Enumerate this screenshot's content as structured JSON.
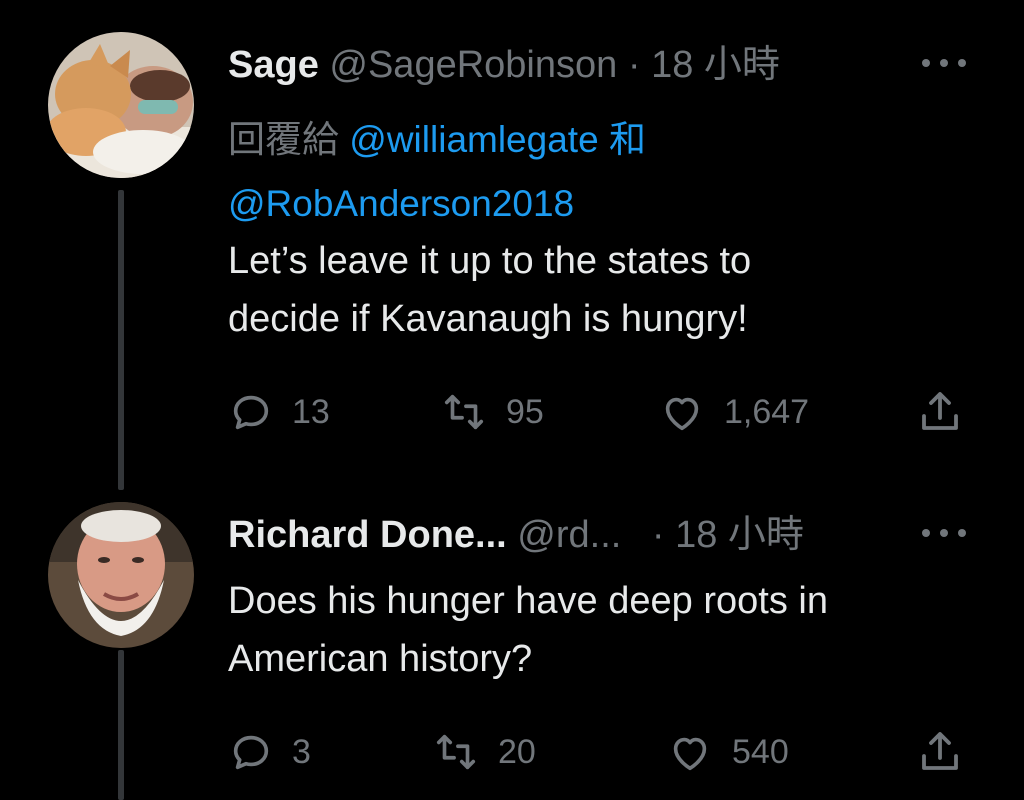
{
  "tweets": [
    {
      "name": "Sage",
      "handle": "@SageRobinson",
      "separator": "·",
      "time": "18 小時",
      "reply_prefix": "回覆給",
      "reply_mention_1": "@williamlegate",
      "reply_conjunction": "和",
      "reply_mention_2": "@RobAnderson2018",
      "text_line_1": "Let’s leave it up to the states to",
      "text_line_2": "decide if Kavanaugh is hungry!",
      "replies": "13",
      "retweets": "95",
      "likes": "1,647"
    },
    {
      "name": "Richard Done...",
      "handle": "@rd...",
      "separator": "·",
      "time": "18 小時",
      "text_line_1": "Does his hunger have deep roots in",
      "text_line_2": "American history?",
      "replies": "3",
      "retweets": "20",
      "likes": "540"
    }
  ],
  "colors": {
    "background": "#000000",
    "primary_text": "#e7e9ea",
    "secondary_text": "#71767b",
    "mention": "#1d9bf0",
    "thread_line": "#333639"
  },
  "icons": [
    "reply-icon",
    "retweet-icon",
    "like-icon",
    "share-icon",
    "more-icon"
  ]
}
